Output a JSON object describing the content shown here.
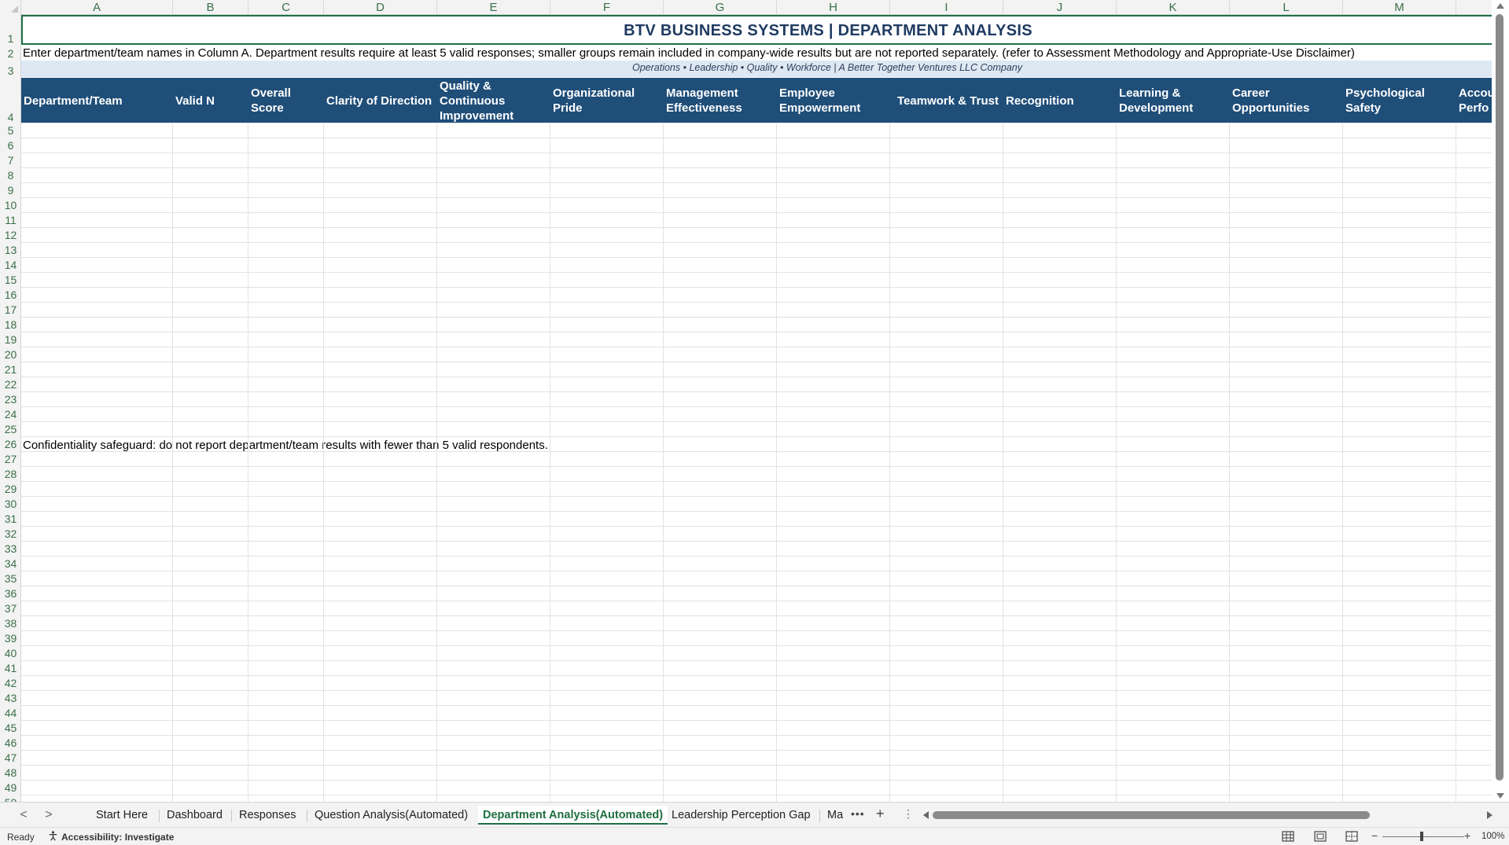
{
  "columns": [
    "A",
    "B",
    "C",
    "D",
    "E",
    "F",
    "G",
    "H",
    "I",
    "J",
    "K",
    "L",
    "M"
  ],
  "rows": [
    "1",
    "2",
    "3",
    "4",
    "5",
    "6",
    "7",
    "8",
    "9",
    "10",
    "11",
    "12",
    "13",
    "14",
    "15",
    "16",
    "17",
    "18",
    "19",
    "20",
    "21",
    "22",
    "23",
    "24",
    "25",
    "26",
    "27",
    "28",
    "29",
    "30",
    "31",
    "32",
    "33",
    "34",
    "35",
    "36",
    "37",
    "38",
    "39",
    "40",
    "41",
    "42",
    "43",
    "44",
    "45",
    "46",
    "47",
    "48",
    "49",
    "50"
  ],
  "sheet": {
    "title": "BTV BUSINESS SYSTEMS | DEPARTMENT ANALYSIS",
    "instructions": "Enter department/team names in Column A. Department results require at least 5 valid responses; smaller groups remain included in company-wide results but are not reported separately. (refer to Assessment Methodology and Appropriate-Use Disclaimer)",
    "tagline": "Operations • Leadership • Quality • Workforce | A Better Together Ventures LLC Company",
    "headers": [
      [
        "Department/Team"
      ],
      [
        "Valid N"
      ],
      [
        "Overall",
        "Score"
      ],
      [
        "Clarity of Direction"
      ],
      [
        "Quality &",
        "Continuous",
        "Improvement"
      ],
      [
        "Organizational",
        "Pride"
      ],
      [
        "Management",
        "Effectiveness"
      ],
      [
        "Employee",
        "Empowerment"
      ],
      [
        "Teamwork & Trust"
      ],
      [
        "Recognition"
      ],
      [
        "Learning &",
        "Development"
      ],
      [
        "Career",
        "Opportunities"
      ],
      [
        "Psychological",
        "Safety"
      ],
      [
        "Accou",
        "Perfo"
      ]
    ],
    "confidentiality_note": "Confidentiality safeguard: do not report department/team results with fewer than 5 valid respondents."
  },
  "tabs": {
    "items": [
      "Start Here",
      "Dashboard",
      "Responses",
      "Question Analysis(Automated)",
      "Department Analysis(Automated)",
      "Leadership Perception Gap",
      "Ma"
    ],
    "active_index": 4,
    "more": "•••",
    "add": "+",
    "options": "⋮",
    "prev": "<",
    "next": ">"
  },
  "status": {
    "ready": "Ready",
    "accessibility": "Accessibility: Investigate",
    "zoom_minus": "−",
    "zoom_plus": "+",
    "zoom": "100%"
  },
  "colors": {
    "header_fill": "#1f4e79",
    "title_text": "#1f3b62",
    "tagline_fill": "#dde8f3",
    "active_tab_text": "#1e6e3f"
  }
}
